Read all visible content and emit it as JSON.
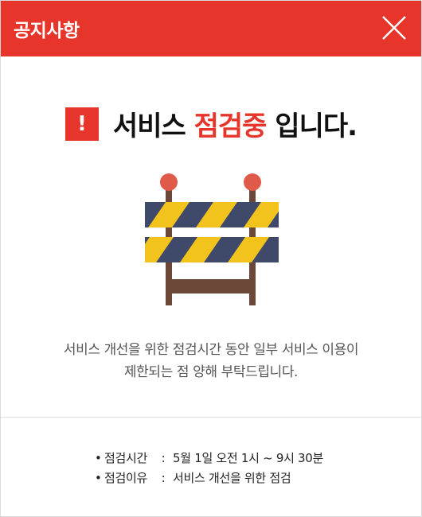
{
  "header": {
    "title": "공지사항",
    "close_icon": "close-icon",
    "brand_color": "#e8352b"
  },
  "notice": {
    "alert_icon_text": "!",
    "title_prefix": "서비스",
    "title_highlight": "점검중",
    "title_suffix": "입니다.",
    "illustration": "barrier-icon"
  },
  "description": {
    "line1": "서비스 개선을 위한 점검시간 동안 일부 서비스 이용이",
    "line2": "제한되는 점 양해 부탁드립니다."
  },
  "details": [
    {
      "bullet": "•",
      "label": "점검시간",
      "separator": ":",
      "value": "5월 1일 오전 1시 ~ 9시 30분"
    },
    {
      "bullet": "•",
      "label": "점검이유",
      "separator": ":",
      "value": "서비스 개선을 위한 점검"
    }
  ]
}
